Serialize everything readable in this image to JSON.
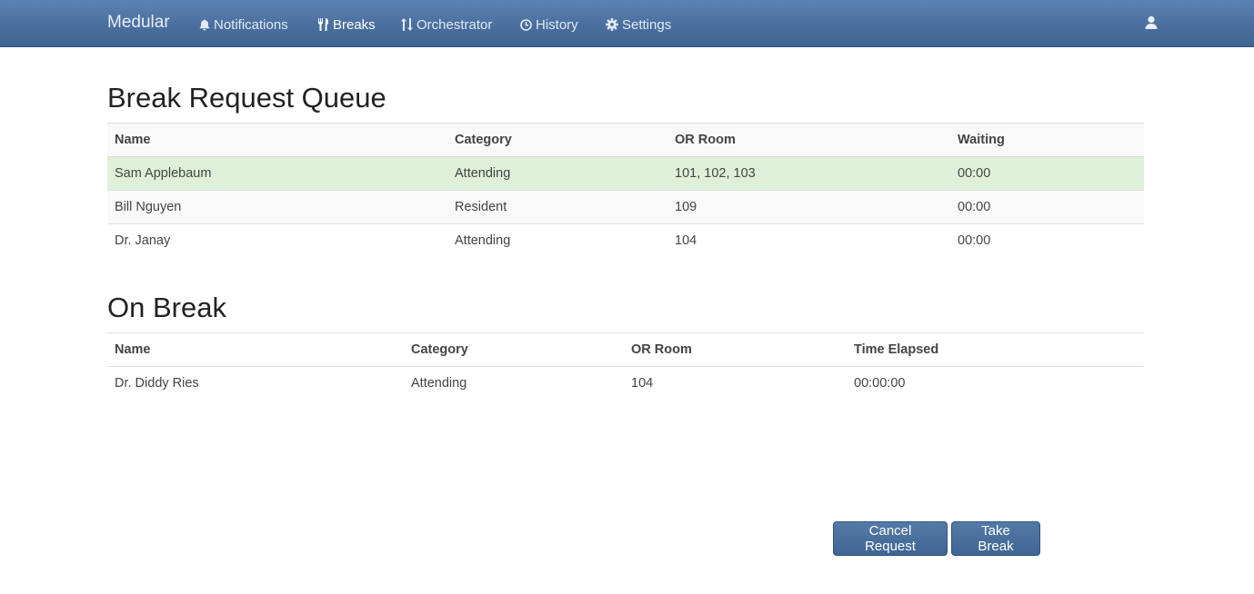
{
  "navbar": {
    "brand": "Medular",
    "items": [
      {
        "label": "Notifications",
        "icon": "bell-icon"
      },
      {
        "label": "Breaks",
        "icon": "cutlery-icon",
        "active": true
      },
      {
        "label": "Orchestrator",
        "icon": "sort-arrows-icon"
      },
      {
        "label": "History",
        "icon": "clock-icon"
      },
      {
        "label": "Settings",
        "icon": "gear-icon"
      }
    ],
    "user_icon": "user-icon"
  },
  "queue": {
    "title": "Break Request Queue",
    "columns": [
      "Name",
      "Category",
      "OR Room",
      "Waiting"
    ],
    "rows": [
      {
        "name": "Sam Applebaum",
        "category": "Attending",
        "room": "101, 102, 103",
        "waiting": "00:00",
        "selected": true
      },
      {
        "name": "Bill Nguyen",
        "category": "Resident",
        "room": "109",
        "waiting": "00:00"
      },
      {
        "name": "Dr. Janay",
        "category": "Attending",
        "room": "104",
        "waiting": "00:00"
      }
    ]
  },
  "on_break": {
    "title": "On Break",
    "columns": [
      "Name",
      "Category",
      "OR Room",
      "Time Elapsed"
    ],
    "rows": [
      {
        "name": "Dr. Diddy Ries",
        "category": "Attending",
        "room": "104",
        "elapsed": "00:00:00"
      }
    ]
  },
  "actions": {
    "cancel_label": "Cancel Request",
    "take_label": "Take Break"
  },
  "colors": {
    "navbar": "#4a6f9e",
    "selected_row": "#dff0d8",
    "button": "#4a6f9e"
  }
}
